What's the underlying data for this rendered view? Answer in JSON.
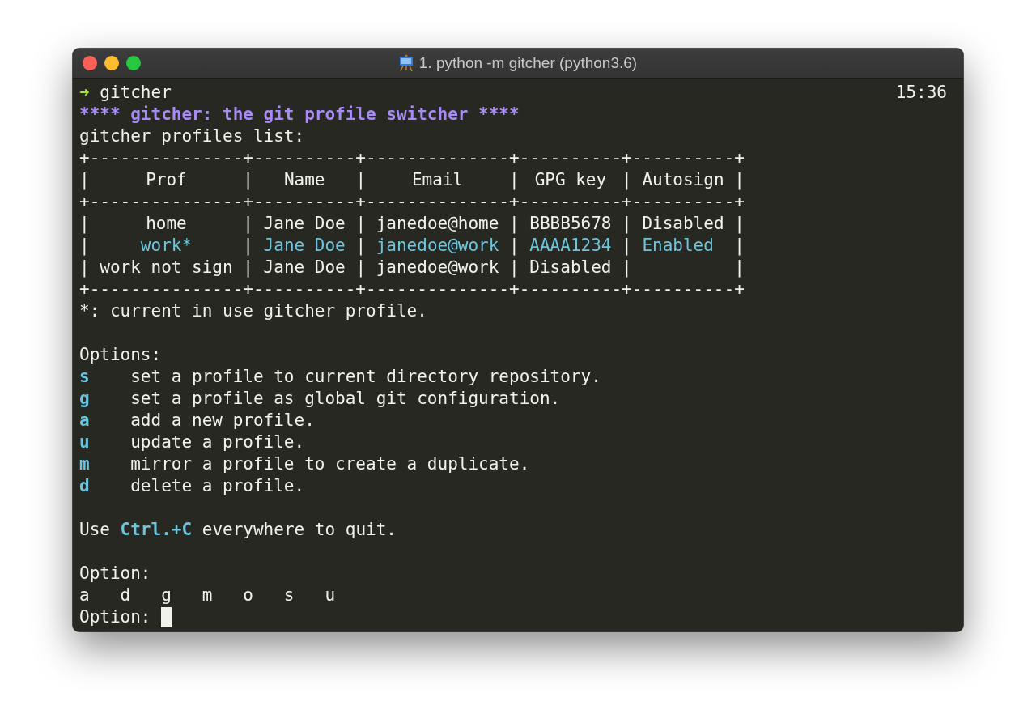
{
  "window": {
    "title": "1. python -m gitcher (python3.6)"
  },
  "prompt": {
    "symbol": "➜",
    "command": "gitcher",
    "clock": "15:36"
  },
  "banner": "**** gitcher: the git profile switcher ****",
  "list_heading": "gitcher profiles list:",
  "table": {
    "borders": [
      "+---------------+----------+--------------+----------+----------+",
      "+---------------+----------+--------------+----------+----------+",
      "+---------------+----------+--------------+----------+----------+"
    ],
    "separator": "|",
    "columns": [
      "Prof",
      "Name",
      "Email",
      "GPG key",
      "Autosign"
    ],
    "rows": [
      {
        "cells": [
          "home",
          "Jane Doe",
          "janedoe@home",
          "BBBB5678",
          "Disabled"
        ],
        "current": false
      },
      {
        "cells": [
          "work*",
          "Jane Doe",
          "janedoe@work",
          "AAAA1234",
          "Enabled"
        ],
        "current": true
      },
      {
        "cells": [
          "work not sign",
          "Jane Doe",
          "janedoe@work",
          "Disabled"
        ],
        "current": false
      }
    ]
  },
  "footnote": "*: current in use gitcher profile.",
  "options_heading": "Options:",
  "options": [
    {
      "key": "s",
      "description": "set a profile to current directory repository."
    },
    {
      "key": "g",
      "description": "set a profile as global git configuration."
    },
    {
      "key": "a",
      "description": "add a new profile."
    },
    {
      "key": "u",
      "description": "update a profile."
    },
    {
      "key": "m",
      "description": "mirror a profile to create a duplicate."
    },
    {
      "key": "d",
      "description": "delete a profile."
    }
  ],
  "quit_hint": "Use **Ctrl.+C** everywhere to quit.",
  "choice_label": "Option:",
  "choices": [
    "a",
    "d",
    "g",
    "m",
    "o",
    "s",
    "u"
  ],
  "input_prompt": "Option:"
}
